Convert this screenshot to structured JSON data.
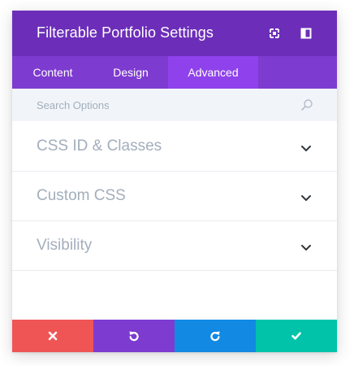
{
  "header": {
    "title": "Filterable Portfolio Settings",
    "icons": [
      "expand-icon",
      "sidebar-icon"
    ],
    "background": "#6c2eb9"
  },
  "tabs": [
    {
      "label": "Content",
      "active": false
    },
    {
      "label": "Design",
      "active": false
    },
    {
      "label": "Advanced",
      "active": true
    }
  ],
  "search": {
    "placeholder": "Search Options",
    "value": ""
  },
  "sections": [
    {
      "label": "CSS ID & Classes",
      "state": "collapsed"
    },
    {
      "label": "Custom CSS",
      "state": "collapsed"
    },
    {
      "label": "Visibility",
      "state": "collapsed"
    }
  ],
  "footer": {
    "buttons": [
      {
        "action": "cancel",
        "icon": "close-icon",
        "color": "#ef5555"
      },
      {
        "action": "undo",
        "icon": "undo-icon",
        "color": "#7e3bd0"
      },
      {
        "action": "redo",
        "icon": "redo-icon",
        "color": "#1289e3"
      },
      {
        "action": "save",
        "icon": "check-icon",
        "color": "#00c3aa"
      }
    ]
  }
}
